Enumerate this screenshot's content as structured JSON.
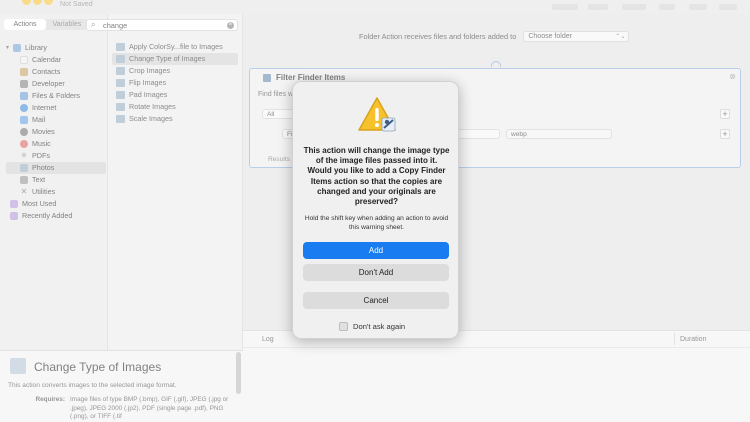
{
  "window": {
    "subtitle": "Not Saved"
  },
  "library": {
    "tabs": [
      {
        "label": "Actions",
        "active": true
      },
      {
        "label": "Variables",
        "active": false
      }
    ],
    "items": [
      {
        "label": "Library",
        "color": "#7aa7d9"
      },
      {
        "label": "Calendar",
        "color": "#e6e6e6"
      },
      {
        "label": "Contacts",
        "color": "#c9a66b"
      },
      {
        "label": "Developer",
        "color": "#888888"
      },
      {
        "label": "Files & Folders",
        "color": "#6f9fd8"
      },
      {
        "label": "Internet",
        "color": "#4a90d9"
      },
      {
        "label": "Mail",
        "color": "#6aa2e0"
      },
      {
        "label": "Movies",
        "color": "#7a7a7a"
      },
      {
        "label": "Music",
        "color": "#e06a6a"
      },
      {
        "label": "PDFs",
        "color": "#aaaaaa"
      },
      {
        "label": "Photos",
        "color": "#9ab0c4"
      },
      {
        "label": "Text",
        "color": "#999999"
      },
      {
        "label": "Utilities",
        "color": "#888888"
      },
      {
        "label": "Most Used",
        "color": "#b59ad9"
      },
      {
        "label": "Recently Added",
        "color": "#b59ad9"
      }
    ]
  },
  "search": {
    "value": "change"
  },
  "actions": {
    "items": [
      {
        "label": "Apply ColorSy...file to Images"
      },
      {
        "label": "Change Type of Images"
      },
      {
        "label": "Crop Images"
      },
      {
        "label": "Flip Images"
      },
      {
        "label": "Pad Images"
      },
      {
        "label": "Rotate Images"
      },
      {
        "label": "Scale Images"
      }
    ]
  },
  "description": {
    "title": "Change Type of Images",
    "body": "This action converts images to the selected image format.",
    "requires_label": "Requires:",
    "requires_text": "Image files of type BMP (.bmp), GIF (.gif), JPEG (.jpg or .jpeg), JPEG 2000 (.jp2), PDF (single page .pdf), PNG (.png), or TIFF (.tif"
  },
  "workflow": {
    "folder_label": "Folder Action receives files and folders added to",
    "folder_select": "Choose folder",
    "card_title": "Filter Finder Items",
    "find_label": "Find files w",
    "all_select": "All",
    "condition_select": "Fi",
    "value_field": "webp",
    "results_label": "Results"
  },
  "log": {
    "col_log": "Log",
    "col_duration": "Duration"
  },
  "dialog": {
    "message": "This action will change the image type of the image files passed into it.  Would you like to add a Copy Finder Items action so that the copies are changed and your originals are preserved?",
    "hint": "Hold the shift key when adding an action to avoid this warning sheet.",
    "add_label": "Add",
    "dont_add_label": "Don't Add",
    "cancel_label": "Cancel",
    "dont_ask_label": "Don't ask again",
    "accent": "#1a7cf1"
  }
}
